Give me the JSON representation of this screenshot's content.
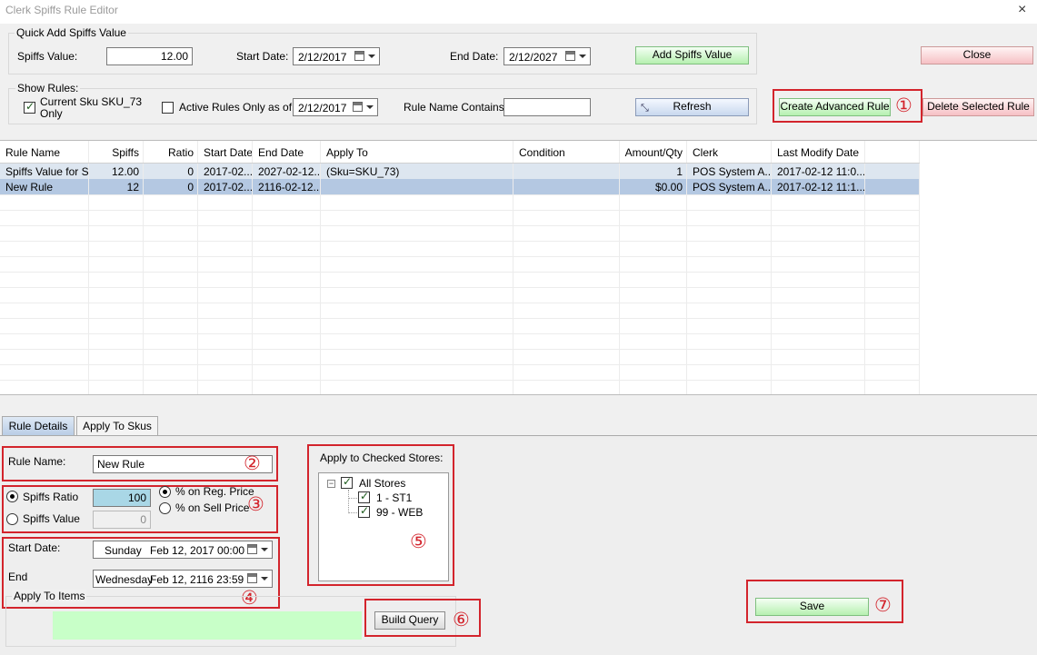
{
  "window": {
    "title": "Clerk Spiffs Rule Editor",
    "close_glyph": "×"
  },
  "quick_add": {
    "group_label": "Quick Add Spiffs Value",
    "spiffs_label": "Spiffs Value:",
    "spiffs_value": "12.00",
    "start_label": "Start Date:",
    "start_date": "2/12/2017",
    "end_label": "End Date:",
    "end_date": "2/12/2027",
    "add_button": "Add Spiffs Value"
  },
  "close_button": "Close",
  "show_rules": {
    "group_label": "Show Rules:",
    "current_sku_label_line1": "Current Sku SKU_73",
    "current_sku_label_line2": "Only",
    "current_sku_checked": true,
    "active_only_label": "Active Rules Only as of",
    "active_only_checked": false,
    "active_date": "2/12/2017",
    "name_contains_label": "Rule Name Contains:",
    "name_contains_value": "",
    "refresh_button": "Refresh"
  },
  "create_advanced_button": "Create Advanced Rule",
  "delete_button": "Delete Selected Rule",
  "markers": [
    "①",
    "②",
    "③",
    "④",
    "⑤",
    "⑥",
    "⑦"
  ],
  "grid": {
    "columns": [
      "Rule Name",
      "Spiffs",
      "Ratio",
      "Start Date",
      "End Date",
      "Apply To",
      "Condition",
      "Amount/Qty",
      "Clerk",
      "Last Modify Date"
    ],
    "rows": [
      [
        "Spiffs Value for S...",
        "12.00",
        "0",
        "2017-02...",
        "2027-02-12...",
        "(Sku=SKU_73)",
        "",
        "1",
        "POS System A...",
        "2017-02-12 11:0..."
      ],
      [
        "New Rule",
        "12",
        "0",
        "2017-02...",
        "2116-02-12...",
        "",
        "",
        "$0.00",
        "POS System A...",
        "2017-02-12 11:1..."
      ]
    ]
  },
  "tabs": [
    "Rule Details",
    "Apply To Skus"
  ],
  "details": {
    "rule_name_label": "Rule Name:",
    "rule_name_value": "New Rule",
    "spiffs_ratio_label": "Spiffs Ratio",
    "spiffs_ratio_value": "100",
    "spiffs_value_label": "Spiffs Value",
    "spiffs_value_value": "0",
    "on_reg_price_label": "% on Reg. Price",
    "on_sell_price_label": "% on Sell Price",
    "start_label": "Start Date:",
    "start_day": "Sunday",
    "start_value": "Feb 12, 2017 00:00",
    "end_label": "End",
    "end_day": "Wednesday",
    "end_value": "Feb 12, 2116 23:59",
    "apply_items_label": "Apply To Items",
    "build_query_button": "Build Query"
  },
  "stores": {
    "label": "Apply to Checked Stores:",
    "root": "All Stores",
    "items": [
      "1 - ST1",
      "99 - WEB"
    ]
  },
  "save_button": "Save",
  "colors": {
    "annotation_red": "#d3242c",
    "selected_row": "#b4c8e2",
    "green_field": "#c8ffc8"
  }
}
